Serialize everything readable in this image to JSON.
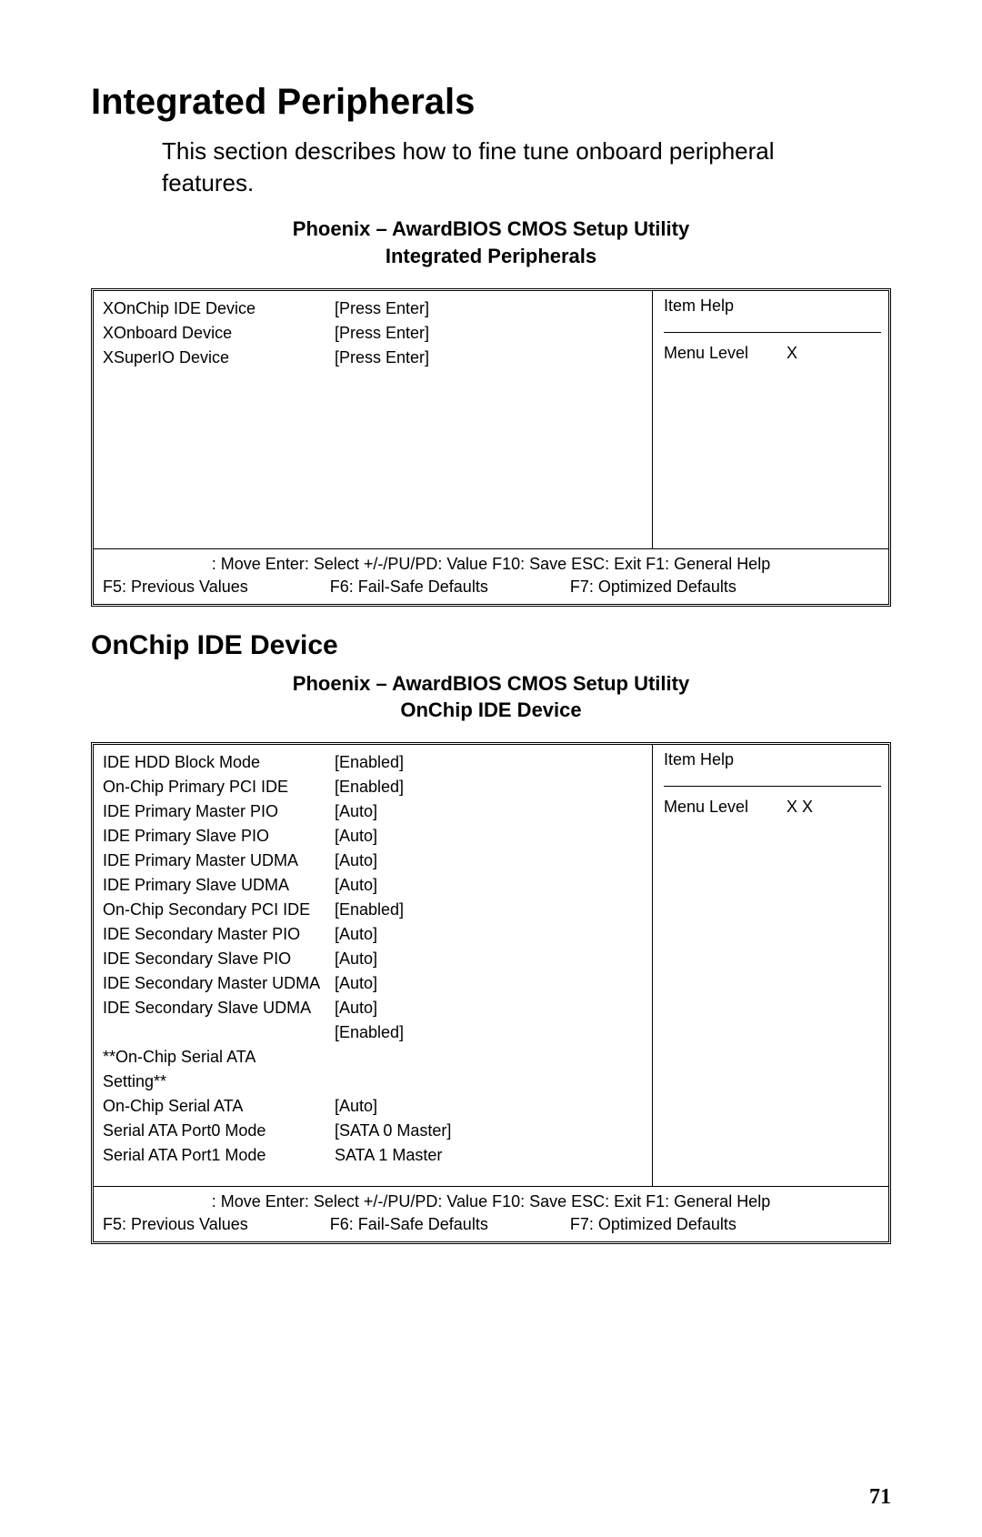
{
  "heading_main": "Integrated Peripherals",
  "intro_text": "This section describes how to fine tune onboard peripheral features.",
  "panel1": {
    "title_line1": "Phoenix – AwardBIOS CMOS Setup Utility",
    "title_line2": "Integrated Peripherals",
    "rows": [
      {
        "label": "XOnChip IDE Device",
        "value": "[Press Enter]"
      },
      {
        "label": "XOnboard Device",
        "value": "[Press Enter]"
      },
      {
        "label": "XSuperIO  Device",
        "value": "[Press Enter]"
      }
    ],
    "help_title": "Item Help",
    "menu_level_label": "Menu Level",
    "menu_level_value": "X",
    "footer_nav": ": Move  Enter: Select  +/-/PU/PD: Value  F10: Save  ESC: Exit  F1: General Help",
    "footer_keys": {
      "f5": "F5: Previous Values",
      "f6": "F6: Fail-Safe Defaults",
      "f7": "F7: Optimized Defaults"
    }
  },
  "subheading": "OnChip IDE Device",
  "panel2": {
    "title_line1": "Phoenix – AwardBIOS CMOS Setup Utility",
    "title_line2": "OnChip IDE Device",
    "rows": [
      {
        "label": "IDE HDD Block Mode",
        "value": "[Enabled]"
      },
      {
        "label": "On-Chip Primary PCI IDE",
        "value": "[Enabled]"
      },
      {
        "label": "IDE Primary Master PIO",
        "value": "[Auto]"
      },
      {
        "label": "IDE Primary Slave PIO",
        "value": "[Auto]"
      },
      {
        "label": "IDE Primary Master UDMA",
        "value": "[Auto]"
      },
      {
        "label": "IDE Primary Slave UDMA",
        "value": "[Auto]"
      },
      {
        "label": "On-Chip Secondary PCI IDE",
        "value": "[Enabled]"
      },
      {
        "label": "IDE Secondary Master PIO",
        "value": "[Auto]"
      },
      {
        "label": "IDE Secondary Slave PIO",
        "value": "[Auto]"
      },
      {
        "label": "IDE Secondary Master UDMA",
        "value": "[Auto]"
      },
      {
        "label": "IDE Secondary Slave UDMA",
        "value": "[Auto]"
      },
      {
        "label": "",
        "value": "[Enabled]"
      }
    ],
    "section_label_line1": "**On-Chip Serial ATA",
    "section_label_line2": "Setting**",
    "rows2": [
      {
        "label": "On-Chip Serial ATA",
        "value": "[Auto]"
      },
      {
        "label": "Serial ATA Port0 Mode",
        "value": "[SATA 0  Master]"
      },
      {
        "label": "Serial ATA Port1 Mode",
        "value": " SATA 1  Master"
      }
    ],
    "help_title": "Item Help",
    "menu_level_label": "Menu Level",
    "menu_level_value": "X X",
    "footer_nav": ": Move  Enter: Select  +/-/PU/PD: Value  F10: Save  ESC: Exit  F1: General Help",
    "footer_keys": {
      "f5": "F5: Previous Values",
      "f6": "F6: Fail-Safe Defaults",
      "f7": "F7: Optimized Defaults"
    }
  },
  "page_number": "71"
}
